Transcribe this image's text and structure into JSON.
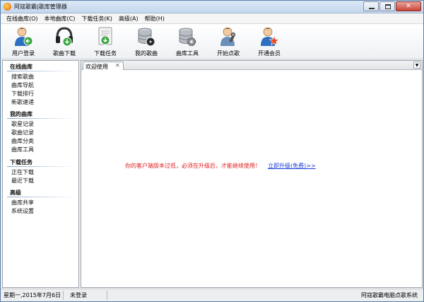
{
  "window": {
    "title": "阿寇歌霸|歌库管理器"
  },
  "menu": {
    "items": [
      {
        "label": "在线曲库(O)"
      },
      {
        "label": "本地曲库(C)"
      },
      {
        "label": "下载任务(K)"
      },
      {
        "label": "高级(A)"
      },
      {
        "label": "帮助(H)"
      }
    ]
  },
  "toolbar": {
    "items": [
      {
        "label": "用户登录",
        "icon": "user-login-icon"
      },
      {
        "label": "歌曲下载",
        "icon": "headphones-download-icon"
      },
      {
        "label": "下载任务",
        "icon": "download-task-icon"
      },
      {
        "label": "我的歌曲",
        "icon": "database-disc-icon"
      },
      {
        "label": "曲库工具",
        "icon": "database-gear-icon"
      },
      {
        "label": "开始点歌",
        "icon": "singer-microphone-icon"
      },
      {
        "label": "开通会员",
        "icon": "user-star-icon"
      }
    ]
  },
  "sidebar": {
    "groups": [
      {
        "title": "在线曲库",
        "items": [
          "搜索歌曲",
          "曲库导航",
          "下载排行",
          "新歌速递"
        ]
      },
      {
        "title": "我的曲库",
        "items": [
          "歌星记录",
          "歌曲记录",
          "曲库分类",
          "曲库工具"
        ]
      },
      {
        "title": "下载任务",
        "items": [
          "正在下载",
          "最近下载"
        ]
      },
      {
        "title": "高级",
        "items": [
          "曲库共享",
          "系统设置"
        ]
      }
    ]
  },
  "tabs": [
    {
      "label": "欢迎使用",
      "close": "✕"
    }
  ],
  "content": {
    "warning": "你的客户端版本过低，必须在升级后，才能继续使用！",
    "upgrade_link": "立即升级(免费)>>"
  },
  "status": {
    "date": "星期一,2015年7月6日",
    "login": "未登录",
    "product": "阿寇歌霸电脑点歌系统"
  },
  "colors": {
    "warning": "#e02020",
    "link": "#1a3cd8"
  }
}
